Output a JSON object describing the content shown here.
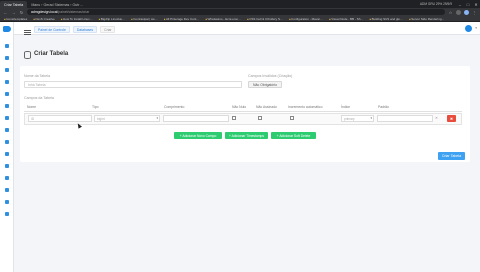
{
  "browser": {
    "tabs": [
      "Criar Tabela",
      "Manu › Gerad Sistemas › Outr…"
    ],
    "url_host": "admgdesign.local",
    "url_path": "/painel/sistemas/criar",
    "system_tray": "ADM  GRU  29%  29/5/9",
    "bookmarks": [
      "Icons/templates",
      "DevS Creative",
      "How To Install Linux…",
      "Bigdrip LinuxHe…",
      "Contrastpal | sw…",
      "All Pinterage Dev Cont…",
      "Whatsaimo - Ecra emo…",
      "CSS Cell & C0rollery S…",
      "Configuration - Mavar…",
      "Visual Node - BB - Sh…",
      "Building SUS and glo…",
      "Server Side Rendering…"
    ]
  },
  "header": {
    "breadcrumbs": [
      "Painel de Controle",
      "Databases",
      "Criar"
    ]
  },
  "page": {
    "title": "Criar Tabela"
  },
  "form": {
    "table_name_label": "Nome da Tabela",
    "table_name_placeholder": "Inhá Tabela",
    "required_fields_label": "Campos Inválidos (Criação)",
    "required_fields_button": "Não Obrigatório",
    "table_fields_label": "Campos da Tabela",
    "columns": [
      "Nome",
      "Tipo",
      "Comprimento",
      "Não Nulo",
      "Não Assinado",
      "Incremento automático",
      "Índice",
      "Padrão"
    ],
    "row": {
      "name": "ID",
      "type": "bigint",
      "index": "primary",
      "default": ""
    },
    "delete_label": "✖",
    "add_field_button": "+ Adicionar Novo Campo",
    "add_timestamps_button": "+ Adicionar Timestamps",
    "add_soft_delete_button": "+ Adicionar Soft Delete",
    "create_button": "Criar Tabela"
  },
  "colors": {
    "primary": "#3fa1f2",
    "success": "#2ecc71",
    "danger": "#e74c3c"
  }
}
